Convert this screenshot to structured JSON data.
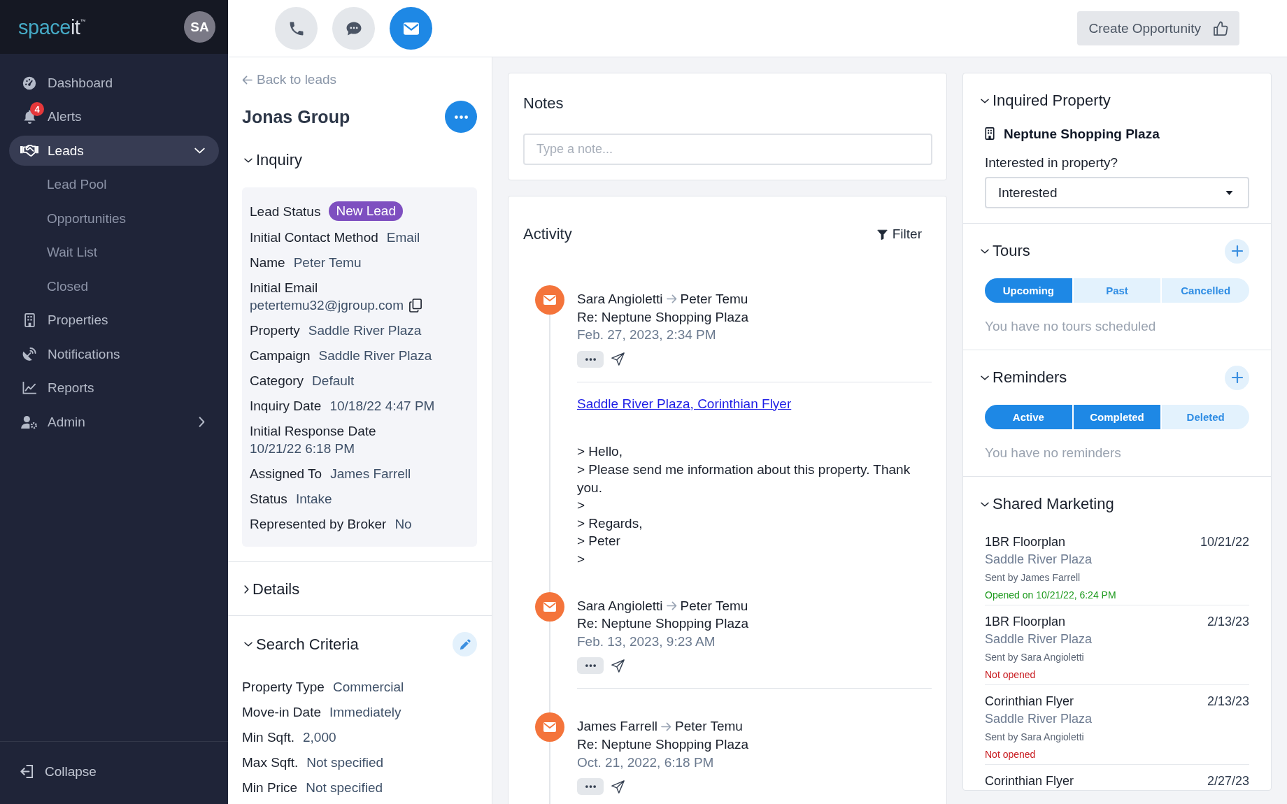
{
  "sidebar": {
    "logo": {
      "main": "space",
      "accent": "it",
      "mark": "™"
    },
    "avatar": "SA",
    "items": [
      {
        "kind": "dashboard",
        "label": "Dashboard",
        "selected": false
      },
      {
        "kind": "alerts",
        "label": "Alerts",
        "badge": "4",
        "selected": false
      },
      {
        "kind": "leads",
        "label": "Leads",
        "selected": true,
        "expanded": true,
        "children": [
          {
            "label": "Lead Pool",
            "selected": false
          },
          {
            "label": "Opportunities",
            "selected": false
          },
          {
            "label": "Wait List",
            "selected": false
          },
          {
            "label": "Closed",
            "selected": false
          }
        ]
      },
      {
        "kind": "properties",
        "label": "Properties",
        "selected": false
      },
      {
        "kind": "notifications",
        "label": "Notifications",
        "selected": false
      },
      {
        "kind": "reports",
        "label": "Reports",
        "selected": false
      },
      {
        "kind": "admin",
        "label": "Admin",
        "selected": false,
        "expanded": false
      }
    ],
    "collapse": "Collapse"
  },
  "toolbar": {
    "actions": [
      {
        "kind": "phone",
        "selected": false
      },
      {
        "kind": "chat",
        "selected": false
      },
      {
        "kind": "email",
        "selected": true
      }
    ],
    "create_button": "Create Opportunity"
  },
  "lead": {
    "back_link": "Back to leads",
    "title": "Jonas Group",
    "sections": [
      {
        "kind": "boxed",
        "title": "Inquiry",
        "expanded": true,
        "fields": [
          {
            "kind": "badge",
            "label": "Lead Status",
            "value": "New Lead"
          },
          {
            "kind": "text",
            "label": "Initial Contact Method",
            "value": "Email"
          },
          {
            "kind": "text",
            "label": "Name",
            "value": "Peter Temu"
          },
          {
            "kind": "copy",
            "label": "Initial Email",
            "value": "petertemu32@jgroup.com"
          },
          {
            "kind": "text",
            "label": "Property",
            "value": "Saddle River Plaza"
          },
          {
            "kind": "text",
            "label": "Campaign",
            "value": "Saddle River Plaza"
          },
          {
            "kind": "text",
            "label": "Category",
            "value": "Default"
          },
          {
            "kind": "text",
            "label": "Inquiry Date",
            "value": "10/18/22 4:47 PM"
          },
          {
            "kind": "text",
            "label": "Initial Response Date",
            "value": "10/21/22 6:18 PM"
          },
          {
            "kind": "text",
            "label": "Assigned To",
            "value": "James Farrell"
          },
          {
            "kind": "text",
            "label": "Status",
            "value": "Intake"
          },
          {
            "kind": "text",
            "label": "Represented by Broker",
            "value": "No"
          }
        ]
      },
      {
        "title": "Details",
        "expanded": false
      },
      {
        "kind": "plain",
        "title": "Search Criteria",
        "expanded": true,
        "editable": true,
        "fields": [
          {
            "kind": "text",
            "label": "Property Type",
            "value": "Commercial"
          },
          {
            "kind": "text",
            "label": "Move-in Date",
            "value": "Immediately"
          },
          {
            "kind": "text",
            "label": "Min Sqft.",
            "value": "2,000"
          },
          {
            "kind": "text",
            "label": "Max Sqft.",
            "value": "Not specified"
          },
          {
            "kind": "text",
            "label": "Min Price",
            "value": "Not specified"
          }
        ]
      }
    ]
  },
  "notes": {
    "title": "Notes",
    "placeholder": "Type a note..."
  },
  "activity": {
    "title": "Activity",
    "filter": "Filter",
    "items": [
      {
        "from": "Sara Angioletti",
        "to": "Peter Temu",
        "subject": "Re: Neptune Shopping Plaza",
        "date": "Feb. 27, 2023, 2:34 PM",
        "link": "Saddle River Plaza, Corinthian Flyer",
        "body": [
          "> Hello,",
          "> Please send me information about this property. Thank you.",
          ">",
          "> Regards,",
          "> Peter",
          ">"
        ]
      },
      {
        "from": "Sara Angioletti",
        "to": "Peter Temu",
        "subject": "Re: Neptune Shopping Plaza",
        "date": "Feb. 13, 2023, 9:23 AM"
      },
      {
        "from": "James Farrell",
        "to": "Peter Temu",
        "subject": "Re: Neptune Shopping Plaza",
        "date": "Oct. 21, 2022, 6:18 PM"
      }
    ]
  },
  "details_panel": {
    "sections": [
      {
        "kind": "property",
        "title": "Inquired Property",
        "expanded": true,
        "property": "Neptune Shopping Plaza",
        "question": "Interested in property?",
        "select_value": "Interested"
      },
      {
        "kind": "tabs",
        "title": "Tours",
        "expanded": true,
        "tabs": [
          {
            "label": "Upcoming",
            "selected": true
          },
          {
            "label": "Past",
            "selected": false
          },
          {
            "label": "Cancelled",
            "selected": false
          }
        ],
        "empty_text": "You have no tours scheduled"
      },
      {
        "kind": "tabs",
        "title": "Reminders",
        "expanded": true,
        "tabs": [
          {
            "label": "Active",
            "selected": true
          },
          {
            "label": "Completed",
            "selected": true
          },
          {
            "label": "Deleted",
            "selected": false
          }
        ],
        "empty_text": "You have no reminders"
      },
      {
        "kind": "marketing",
        "title": "Shared Marketing",
        "expanded": true,
        "items": [
          {
            "title": "1BR Floorplan",
            "date": "10/21/22",
            "property": "Saddle River Plaza",
            "sent_by": "Sent by James Farrell",
            "status": "Opened on 10/21/22, 6:24 PM",
            "opened": true
          },
          {
            "title": "1BR Floorplan",
            "date": "2/13/23",
            "property": "Saddle River Plaza",
            "sent_by": "Sent by Sara Angioletti",
            "status": "Not opened",
            "opened": false
          },
          {
            "title": "Corinthian Flyer",
            "date": "2/13/23",
            "property": "Saddle River Plaza",
            "sent_by": "Sent by Sara Angioletti",
            "status": "Not opened",
            "opened": false
          },
          {
            "title": "Corinthian Flyer",
            "date": "2/27/23"
          }
        ]
      }
    ]
  }
}
